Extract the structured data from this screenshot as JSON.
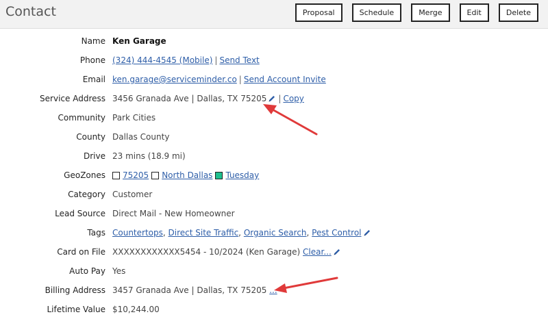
{
  "header": {
    "title": "Contact",
    "buttons": {
      "proposal": "Proposal",
      "schedule": "Schedule",
      "merge": "Merge",
      "edit": "Edit",
      "delete": "Delete"
    }
  },
  "labels": {
    "name": "Name",
    "phone": "Phone",
    "email": "Email",
    "service_address": "Service Address",
    "community": "Community",
    "county": "County",
    "drive": "Drive",
    "geozones": "GeoZones",
    "category": "Category",
    "lead_source": "Lead Source",
    "tags": "Tags",
    "card_on_file": "Card on File",
    "auto_pay": "Auto Pay",
    "billing_address": "Billing Address",
    "lifetime_value": "Lifetime Value"
  },
  "contact": {
    "name": "Ken Garage",
    "phone": "(324) 444-4545 (Mobile)",
    "send_text": "Send Text",
    "email": "ken.garage@serviceminder.co",
    "send_account_invite": "Send Account Invite",
    "service_address": "3456 Granada Ave | Dallas, TX 75205",
    "copy": "Copy",
    "community": "Park Cities",
    "county": "Dallas County",
    "drive": "23 mins (18.9 mi)",
    "geozones": [
      {
        "label": "75205",
        "color": "#ffffff"
      },
      {
        "label": "North Dallas",
        "color": "#ffffff"
      },
      {
        "label": "Tuesday",
        "color": "#1fbf8f"
      }
    ],
    "category": "Customer",
    "lead_source": "Direct Mail - New Homeowner",
    "tags": [
      "Countertops",
      "Direct Site Traffic",
      "Organic Search",
      "Pest Control"
    ],
    "card_on_file": "XXXXXXXXXXXX5454 - 10/2024 (Ken Garage)",
    "card_clear": "Clear...",
    "auto_pay": "Yes",
    "billing_address": "3457 Granada Ave | Dallas, TX 75205",
    "billing_more": "...",
    "lifetime_value": "$10,244.00"
  },
  "colors": {
    "link": "#2e5ea8",
    "annotation_arrow": "#e03a3a",
    "geozone_green": "#1fbf8f"
  }
}
